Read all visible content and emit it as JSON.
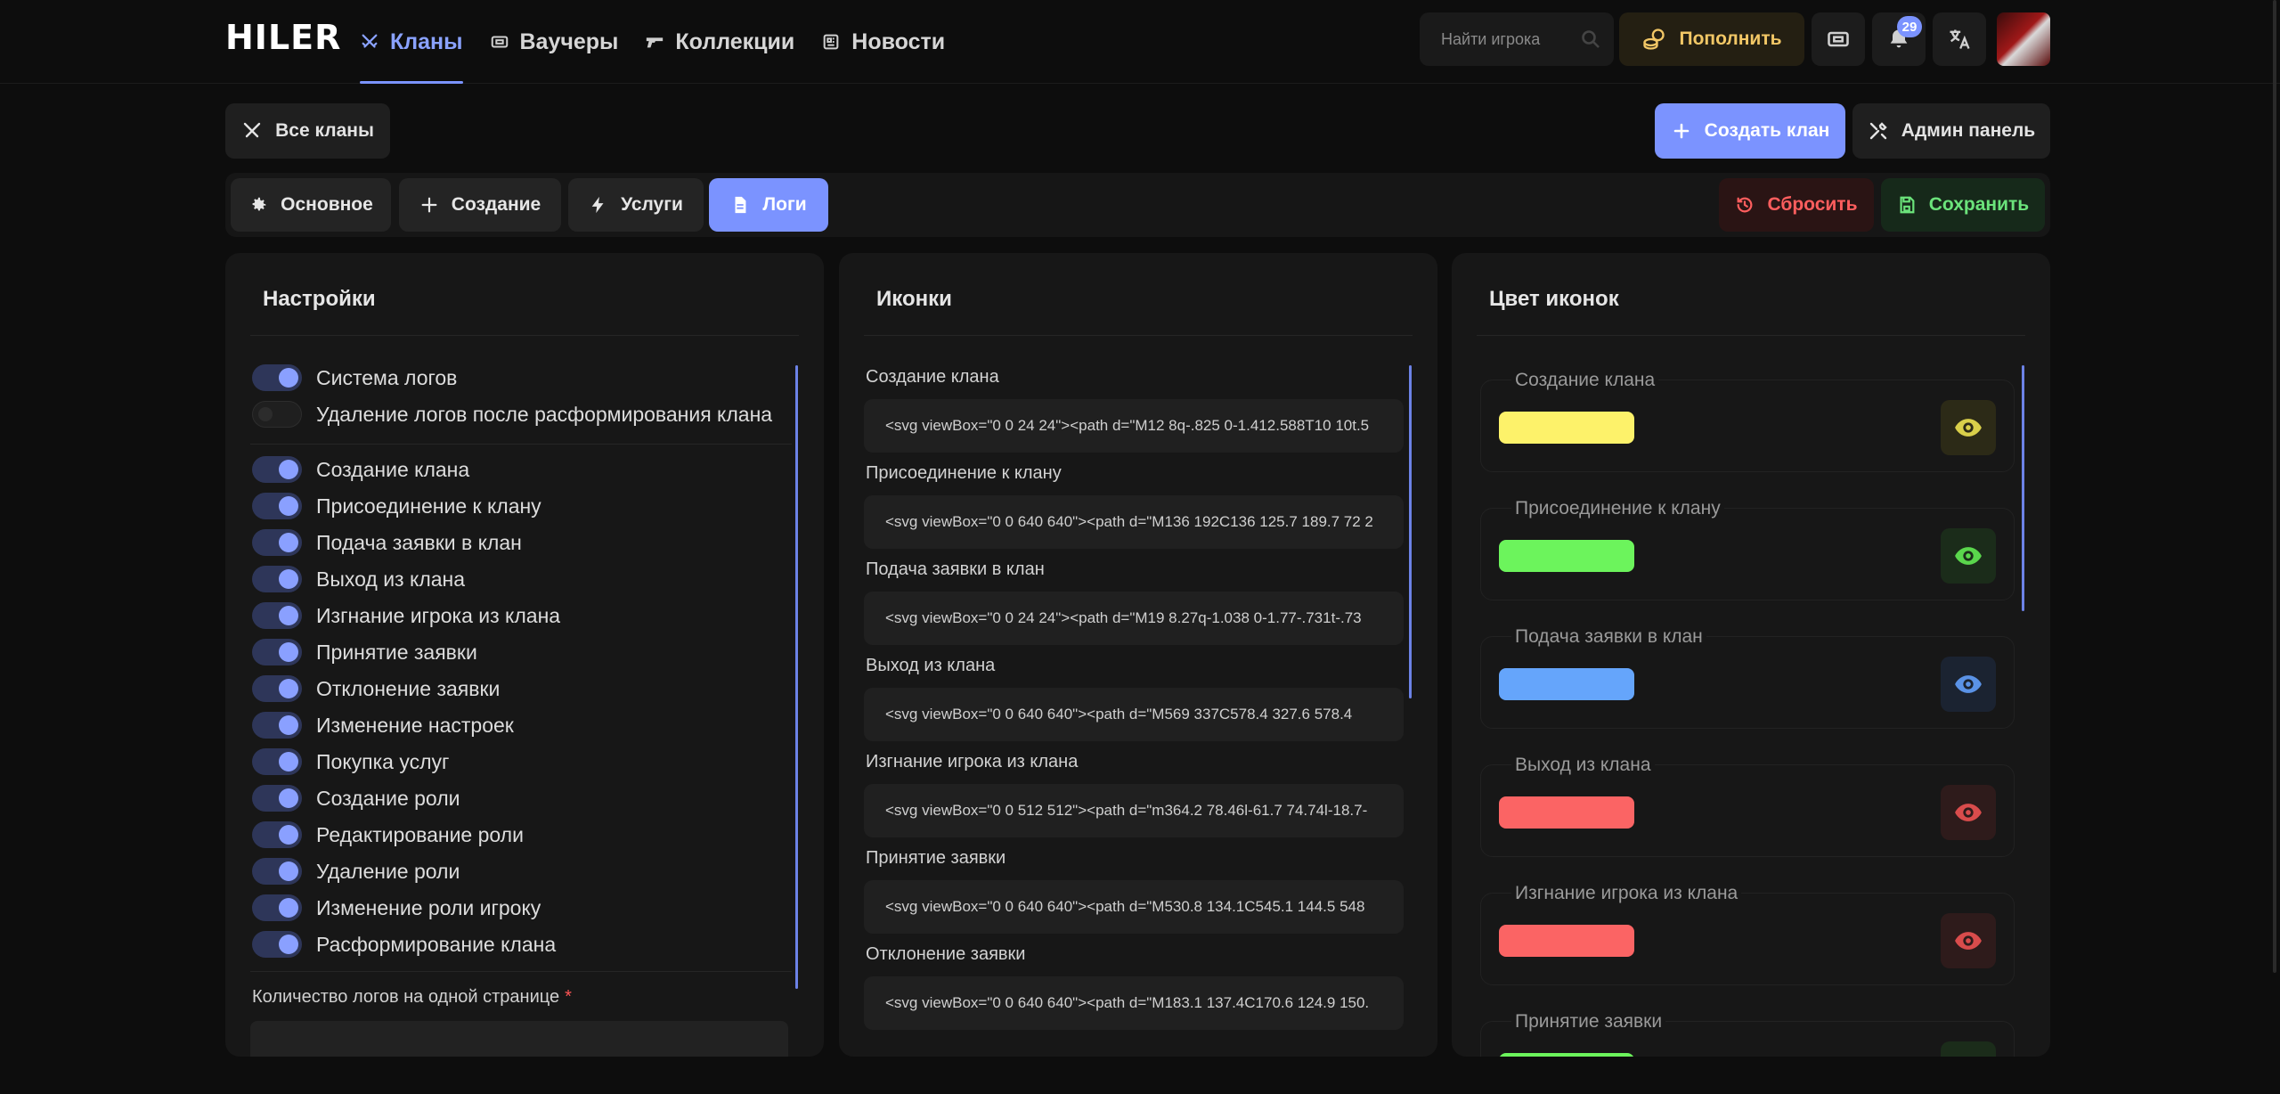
{
  "app": {
    "logo": "HILER",
    "nav": [
      {
        "label": "Кланы",
        "active": true,
        "icon": "swords-icon"
      },
      {
        "label": "Ваучеры",
        "active": false,
        "icon": "ticket-icon"
      },
      {
        "label": "Коллекции",
        "active": false,
        "icon": "gun-icon"
      },
      {
        "label": "Новости",
        "active": false,
        "icon": "newspaper-icon"
      }
    ],
    "search_placeholder": "Найти игрока",
    "topup_label": "Пополнить",
    "notifications_count": "29",
    "accent_color": "#7b93ff"
  },
  "actions": {
    "all_clans": "Все кланы",
    "create_clan": "Создать клан",
    "admin_panel": "Админ панель"
  },
  "tabs": {
    "main": "Основное",
    "creation": "Создание",
    "services": "Услуги",
    "logs": "Логи",
    "active": "logs",
    "reset": "Сбросить",
    "save": "Сохранить"
  },
  "settings": {
    "title": "Настройки",
    "toggles": [
      {
        "label": "Система логов",
        "on": true
      },
      {
        "label": "Удаление логов после расформирования клана",
        "on": false
      },
      {
        "label": "Создание клана",
        "on": true
      },
      {
        "label": "Присоединение к клану",
        "on": true
      },
      {
        "label": "Подача заявки в клан",
        "on": true
      },
      {
        "label": "Выход из клана",
        "on": true
      },
      {
        "label": "Изгнание игрока из клана",
        "on": true
      },
      {
        "label": "Принятие заявки",
        "on": true
      },
      {
        "label": "Отклонение заявки",
        "on": true
      },
      {
        "label": "Изменение настроек",
        "on": true
      },
      {
        "label": "Покупка услуг",
        "on": true
      },
      {
        "label": "Создание роли",
        "on": true
      },
      {
        "label": "Редактирование роли",
        "on": true
      },
      {
        "label": "Удаление роли",
        "on": true
      },
      {
        "label": "Изменение роли игроку",
        "on": true
      },
      {
        "label": "Расформирование клана",
        "on": true
      }
    ],
    "page_size_label": "Количество логов на одной странице",
    "required_mark": "*"
  },
  "icons": {
    "title": "Иконки",
    "items": [
      {
        "label": "Создание клана",
        "value": "<svg viewBox=\"0 0 24 24\"><path d=\"M12 8q-.825 0-1.412.588T10 10t.5"
      },
      {
        "label": "Присоединение к клану",
        "value": "<svg viewBox=\"0 0 640 640\"><path d=\"M136 192C136 125.7 189.7 72 2"
      },
      {
        "label": "Подача заявки в клан",
        "value": "<svg viewBox=\"0 0 24 24\"><path d=\"M19 8.27q-1.038 0-1.77-.731t-.73"
      },
      {
        "label": "Выход из клана",
        "value": "<svg viewBox=\"0 0 640 640\"><path d=\"M569 337C578.4 327.6 578.4"
      },
      {
        "label": "Изгнание игрока из клана",
        "value": "<svg viewBox=\"0 0 512 512\"><path d=\"m364.2 78.46l-61.7 74.74l-18.7-"
      },
      {
        "label": "Принятие заявки",
        "value": "<svg viewBox=\"0 0 640 640\"><path d=\"M530.8 134.1C545.1 144.5 548"
      },
      {
        "label": "Отклонение заявки",
        "value": "<svg viewBox=\"0 0 640 640\"><path d=\"M183.1 137.4C170.6 124.9 150."
      }
    ]
  },
  "icon_colors": {
    "title": "Цвет иконок",
    "items": [
      {
        "label": "Создание клана",
        "color": "#fdf26a",
        "eye_color": "#d9cf4a",
        "eye_bg": "#2c2a17"
      },
      {
        "label": "Присоединение к клану",
        "color": "#6cf45c",
        "eye_color": "#5ad64c",
        "eye_bg": "#1b2c1a"
      },
      {
        "label": "Подача заявки в клан",
        "color": "#65a5fb",
        "eye_color": "#5a92e6",
        "eye_bg": "#1b2331"
      },
      {
        "label": "Выход из клана",
        "color": "#fb6464",
        "eye_color": "#d94c4c",
        "eye_bg": "#2e1b1b"
      },
      {
        "label": "Изгнание игрока из клана",
        "color": "#fb6464",
        "eye_color": "#d94c4c",
        "eye_bg": "#2e1b1b"
      },
      {
        "label": "Принятие заявки",
        "color": "#6cf45c",
        "eye_color": "#5ad64c",
        "eye_bg": "#1b2c1a"
      }
    ]
  }
}
